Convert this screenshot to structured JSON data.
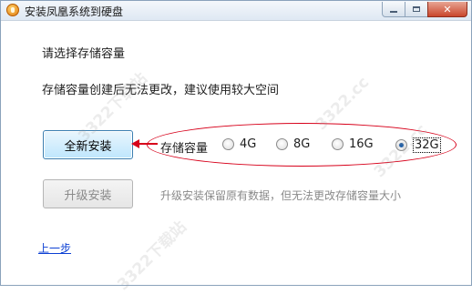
{
  "window": {
    "title": "安装凤凰系统到硬盘",
    "close_glyph": "✕"
  },
  "main": {
    "prompt": "请选择存储容量",
    "note": "存储容量创建后无法更改，建议使用较大空间"
  },
  "buttons": {
    "new_install": "全新安装",
    "upgrade_install": "升级安装"
  },
  "capacity": {
    "label": "存储容量",
    "options": [
      {
        "label": "4G",
        "selected": false
      },
      {
        "label": "8G",
        "selected": false
      },
      {
        "label": "16G",
        "selected": false
      },
      {
        "label": "32G",
        "selected": true
      }
    ]
  },
  "upgrade_note": "升级安装保留原有数据，但无法更改存储容量大小",
  "back_link": "上一步",
  "watermarks": [
    "3322下载站",
    "3322.cc",
    "3322.cc",
    "3322下载站"
  ],
  "colors": {
    "annotation_red": "#d7001a",
    "link_blue": "#0b3fd3",
    "radio_selected": "#1f5fa8"
  },
  "icons": [
    "app-icon",
    "minimize-icon",
    "maximize-icon",
    "close-icon",
    "arrow-annotation"
  ]
}
